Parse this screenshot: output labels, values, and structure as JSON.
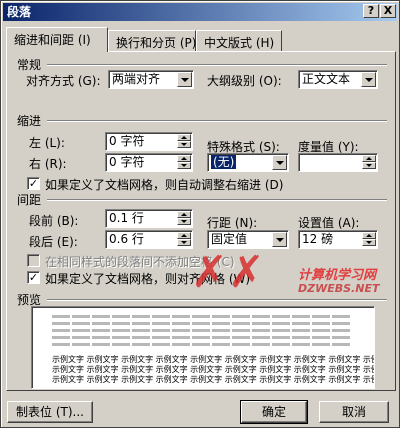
{
  "window": {
    "title": "段落",
    "help": "?",
    "close": "X"
  },
  "tabs": [
    "缩进和间距 (I)",
    "换行和分页 (P)",
    "中文版式 (H)"
  ],
  "general": {
    "section": "常规",
    "alignment_label": "对齐方式 (G):",
    "alignment_value": "两端对齐",
    "outline_label": "大纲级别 (O):",
    "outline_value": "正文文本"
  },
  "indent": {
    "section": "缩进",
    "left_label": "左 (L):",
    "left_value": "0 字符",
    "right_label": "右 (R):",
    "right_value": "0 字符",
    "special_label": "特殊格式 (S):",
    "special_value": "(无)",
    "by_label": "度量值 (Y):",
    "by_value": "",
    "auto_adjust": "如果定义了文档网格，则自动调整右缩进 (D)",
    "auto_adjust_checked": true
  },
  "spacing": {
    "section": "间距",
    "before_label": "段前 (B):",
    "before_value": "0.1 行",
    "after_label": "段后 (E):",
    "after_value": "0.6 行",
    "line_label": "行距 (N):",
    "line_value": "固定值",
    "at_label": "设置值 (A):",
    "at_value": "12 磅",
    "no_space_same_style": "在相同样式的段落间不添加空格 (C)",
    "no_space_checked": false,
    "snap_to_grid": "如果定义了文档网格，则对齐网格 (W)",
    "snap_checked": true
  },
  "preview": {
    "section": "预览",
    "sample": "示例文字 示例文字 示例文字 示例文字 示例文字 示例文字 示例文字 示例文字 示例文字 示例文字"
  },
  "watermark": {
    "cn": "计算机学习网",
    "en": "DZWEBS.NET"
  },
  "buttons": {
    "tabs": "制表位 (T)...",
    "ok": "确定",
    "cancel": "取消"
  }
}
